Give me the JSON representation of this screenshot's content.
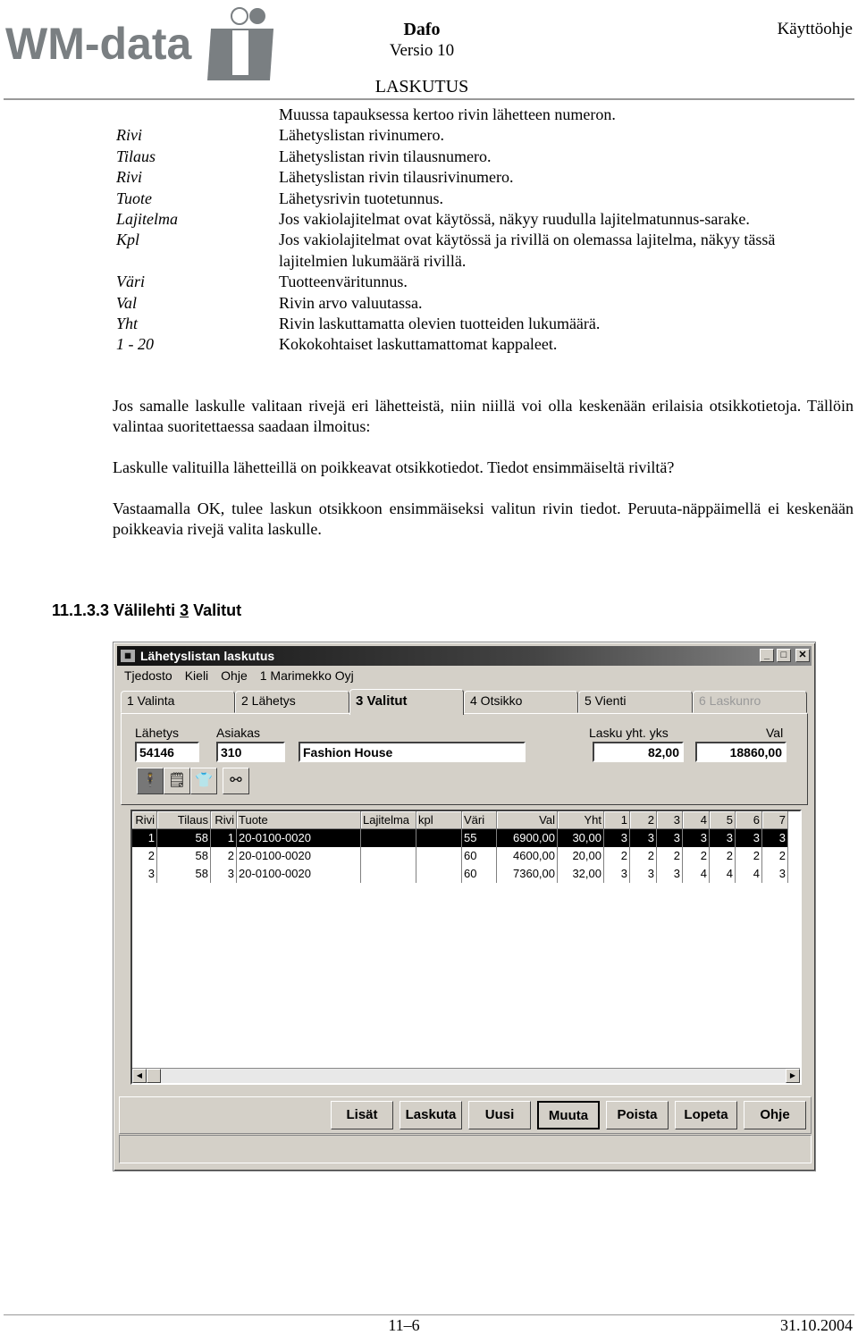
{
  "header": {
    "logo_text": "WM-data",
    "product": "Dafo",
    "version": "Versio 10",
    "doc_type": "Käyttöohje",
    "section": "LASKUTUS"
  },
  "definitions": [
    {
      "label": "",
      "desc": "Muussa tapauksessa kertoo rivin lähetteen numeron."
    },
    {
      "label": "Rivi",
      "desc": "Lähetyslistan rivinumero."
    },
    {
      "label": "Tilaus",
      "desc": "Lähetyslistan rivin tilausnumero."
    },
    {
      "label": "Rivi",
      "desc": "Lähetyslistan rivin tilausrivinumero."
    },
    {
      "label": "Tuote",
      "desc": "Lähetysrivin tuotetunnus."
    },
    {
      "label": "Lajitelma",
      "desc": "Jos vakiolajitelmat ovat käytössä, näkyy ruudulla lajitelmatunnus-sarake."
    },
    {
      "label": "Kpl",
      "desc": "Jos vakiolajitelmat ovat käytössä ja rivillä on olemassa lajitelma, näkyy tässä lajitelmien lukumäärä rivillä."
    },
    {
      "label": "Väri",
      "desc": "Tuotteenväritunnus."
    },
    {
      "label": "Val",
      "desc": "Rivin arvo valuutassa."
    },
    {
      "label": "Yht",
      "desc": "Rivin laskuttamatta olevien tuotteiden lukumäärä."
    },
    {
      "label": "1 - 20",
      "desc": "Kokokohtaiset laskuttamattomat kappaleet."
    }
  ],
  "paragraphs": [
    "Jos samalle laskulle valitaan rivejä eri lähetteistä, niin niillä voi olla keskenään erilaisia otsikkotietoja. Tällöin valintaa suoritettaessa saadaan ilmoitus:",
    "Laskulle valituilla lähetteillä on poikkeavat otsikkotiedot. Tiedot ensimmäiseltä riviltä?",
    "Vastaamalla OK, tulee laskun otsikkoon ensimmäiseksi valitun rivin tiedot. Peruuta-näppäimellä ei keskenään poikkeavia rivejä valita laskulle."
  ],
  "section_heading": {
    "prefix": "11.1.3.3 Välilehti ",
    "key": "3",
    "suffix": " Valitut"
  },
  "window": {
    "title": "Lähetyslistan laskutus",
    "menu": [
      "Tjedosto",
      "Kieli",
      "Ohje",
      "1 Marimekko Oyj"
    ],
    "tabs": [
      {
        "label": "1 Valinta"
      },
      {
        "label": "2 Lähetys"
      },
      {
        "label": "3 Valitut",
        "active": true
      },
      {
        "label": "4 Otsikko"
      },
      {
        "label": "5 Vienti"
      },
      {
        "label": "6 Laskunro",
        "disabled": true
      }
    ],
    "fields": {
      "lahetys_label": "Lähetys",
      "lahetys": "54146",
      "asiakas_label": "Asiakas",
      "asiakas": "310",
      "asiakas_name": "Fashion House",
      "lasku_label": "Lasku yht. yks",
      "lasku": "82,00",
      "val_label": "Val",
      "val": "18860,00"
    },
    "toolbar": [
      "person-icon",
      "note-icon",
      "garment-icon",
      "binoculars-icon"
    ],
    "grid": {
      "columns": [
        "Rivi",
        "Tilaus",
        "Rivi",
        "Tuote",
        "Lajitelma",
        "kpl",
        "Väri",
        "Val",
        "Yht",
        "1",
        "2",
        "3",
        "4",
        "5",
        "6",
        "7"
      ],
      "rows": [
        [
          "1",
          "58",
          "1",
          "20-0100-0020",
          "",
          "",
          "55",
          "6900,00",
          "30,00",
          "3",
          "3",
          "3",
          "3",
          "3",
          "3",
          "3"
        ],
        [
          "2",
          "58",
          "2",
          "20-0100-0020",
          "",
          "",
          "60",
          "4600,00",
          "20,00",
          "2",
          "2",
          "2",
          "2",
          "2",
          "2",
          "2"
        ],
        [
          "3",
          "58",
          "3",
          "20-0100-0020",
          "",
          "",
          "60",
          "7360,00",
          "32,00",
          "3",
          "3",
          "3",
          "4",
          "4",
          "4",
          "3"
        ]
      ],
      "selected_row": 0
    },
    "buttons": [
      "Lisät",
      "Laskuta",
      "Uusi",
      "Muuta",
      "Poista",
      "Lopeta",
      "Ohje"
    ],
    "default_button": "Muuta"
  },
  "footer": {
    "page": "11–6",
    "date": "31.10.2004"
  }
}
